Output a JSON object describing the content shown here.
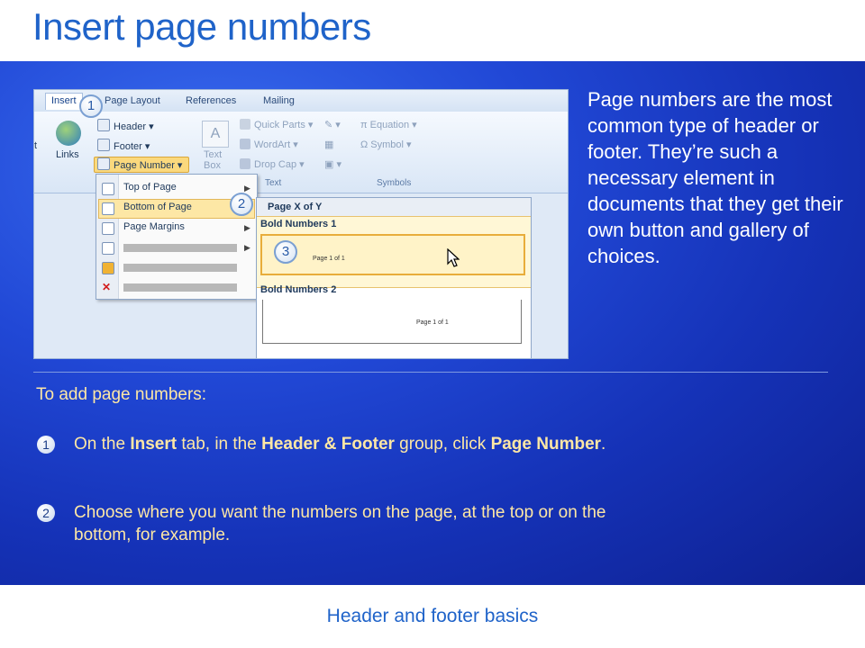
{
  "slide": {
    "title": "Insert page numbers",
    "footer": "Header and footer basics"
  },
  "screenshot": {
    "tabs": [
      "Insert",
      "Page Layout",
      "References",
      "Mailing"
    ],
    "ribbon": {
      "links_label": "Links",
      "header_label": "Header",
      "footer_label": "Footer",
      "page_number_label": "Page Number",
      "text_box_label": "Text Box",
      "quick_parts_label": "Quick Parts",
      "wordart_label": "WordArt",
      "drop_cap_label": "Drop Cap",
      "equation_label": "Equation",
      "symbol_label": "Symbol",
      "text_group": "Text",
      "symbols_group": "Symbols",
      "left_fragment": "t"
    },
    "menu": {
      "items": [
        "Top of Page",
        "Bottom of Page",
        "Page Margins"
      ]
    },
    "gallery": {
      "header": "Page X of Y",
      "sections": [
        "Bold Numbers 1",
        "Bold Numbers 2"
      ],
      "preview_text": "Page 1 of 1"
    },
    "callouts": [
      "1",
      "2",
      "3"
    ]
  },
  "description": "Page numbers are the most common type of header or footer. They’re such a necessary element in documents that they get their own button and gallery of choices.",
  "steps": {
    "intro": "To add page numbers:",
    "items": [
      {
        "number": "1",
        "parts": [
          "On the ",
          "Insert",
          " tab, in the ",
          "Header & Footer",
          " group, click ",
          "Page Number",
          "."
        ]
      },
      {
        "number": "2",
        "text": "Choose where you want the numbers on the page, at the top or on the bottom, for example."
      }
    ]
  },
  "colors": {
    "title": "#1f63c9",
    "steps": "#fde7a5",
    "description": "#ffffff",
    "highlight": "#fbd97d"
  }
}
